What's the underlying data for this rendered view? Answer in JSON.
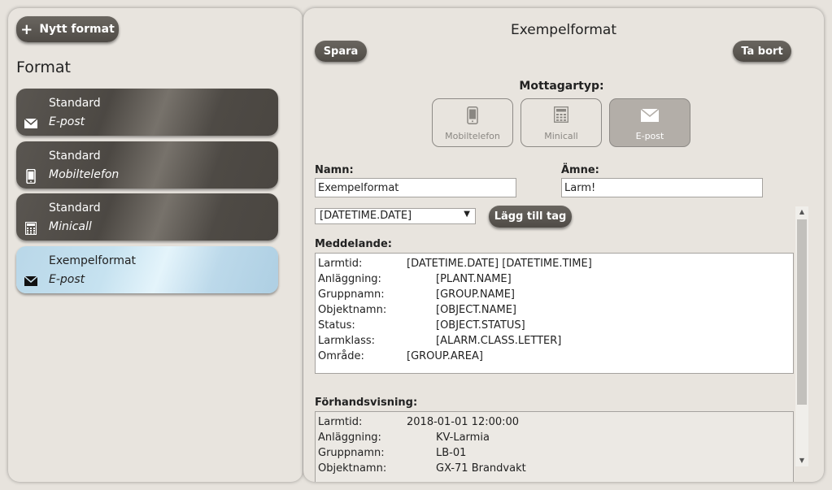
{
  "left": {
    "new_button_label": "Nytt format",
    "heading": "Format",
    "formats": [
      {
        "name": "Standard",
        "type": "E-post",
        "icon": "envelope-icon"
      },
      {
        "name": "Standard",
        "type": "Mobiltelefon",
        "icon": "mobile-phone-icon"
      },
      {
        "name": "Standard",
        "type": "Minicall",
        "icon": "calculator-icon"
      },
      {
        "name": "Exempelformat",
        "type": "E-post",
        "icon": "envelope-icon",
        "selected": true
      }
    ]
  },
  "editor": {
    "title": "Exempelformat",
    "save_label": "Spara",
    "delete_label": "Ta bort",
    "receiver_label": "Mottagartyp:",
    "receivers": [
      {
        "label": "Mobiltelefon",
        "icon": "mobile-phone-icon",
        "active": false
      },
      {
        "label": "Minicall",
        "icon": "calculator-icon",
        "active": false
      },
      {
        "label": "E-post",
        "icon": "envelope-icon",
        "active": true
      }
    ],
    "name_label": "Namn:",
    "name_value": "Exempelformat",
    "subject_label": "Ämne:",
    "subject_value": "Larm!",
    "tag_select_value": "[DATETIME.DATE]",
    "add_tag_label": "Lägg till tag",
    "message_label": "Meddelande:",
    "message_lines": [
      {
        "key": "Larmtid:",
        "value": "[DATETIME.DATE] [DATETIME.TIME]"
      },
      {
        "key": "Anläggning:",
        "value": "[PLANT.NAME]"
      },
      {
        "key": "Gruppnamn:",
        "value": "[GROUP.NAME]"
      },
      {
        "key": "Objektnamn:",
        "value": "[OBJECT.NAME]"
      },
      {
        "key": "Status:",
        "value": "[OBJECT.STATUS]"
      },
      {
        "key": "Larmklass:",
        "value": "[ALARM.CLASS.LETTER]"
      },
      {
        "key": "Område:",
        "value": "[GROUP.AREA]"
      }
    ],
    "preview_label": "Förhandsvisning:",
    "preview_lines": [
      {
        "key": "Larmtid:",
        "value": "2018-01-01 12:00:00"
      },
      {
        "key": "Anläggning:",
        "value": "KV-Larmia"
      },
      {
        "key": "Gruppnamn:",
        "value": "LB-01"
      },
      {
        "key": "Objektnamn:",
        "value": "GX-71 Brandvakt"
      }
    ]
  },
  "colors": {
    "panel_bg": "#e8e4de",
    "dark_button": "#4f4b46",
    "selected_item": "#c6e2f0",
    "active_receiver": "#b3aea8"
  }
}
